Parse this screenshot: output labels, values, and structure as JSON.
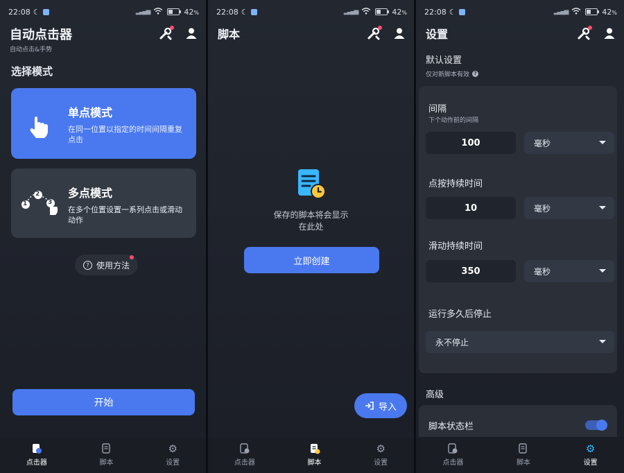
{
  "status": {
    "time": "22:08",
    "battery": "42",
    "battery_unit": "%"
  },
  "colors": {
    "accent": "#4a79ef",
    "card_dark": "#353b45",
    "alert": "#ff4d6d"
  },
  "screen1": {
    "title": "自动点击器",
    "subtitle": "自动点击&手势",
    "section_title": "选择模式",
    "single": {
      "title": "单点模式",
      "desc": "在同一位置以指定的时间间隔重复点击",
      "icon": "tap-hand-icon"
    },
    "multi": {
      "title": "多点模式",
      "desc": "在多个位置设置一系列点击或滑动动作",
      "icon": "multi-point-icon",
      "points": [
        "1",
        "2",
        "3"
      ]
    },
    "howto_label": "使用方法",
    "start_label": "开始"
  },
  "screen2": {
    "title": "脚本",
    "empty_line1": "保存的脚本将会显示",
    "empty_line2": "在此处",
    "create_label": "立即创建",
    "import_label": "导入"
  },
  "screen3": {
    "title": "设置",
    "default_heading": "默认设置",
    "default_note": "仅对新脚本有效",
    "interval": {
      "label": "间隔",
      "sub": "下个动作前的间隔",
      "value": "100",
      "unit": "毫秒"
    },
    "press": {
      "label": "点按持续时间",
      "value": "10",
      "unit": "毫秒"
    },
    "swipe": {
      "label": "滑动持续时间",
      "value": "350",
      "unit": "毫秒"
    },
    "stop": {
      "label": "运行多久后停止",
      "value": "永不停止"
    },
    "advanced_heading": "高级",
    "statusbar_label": "脚本状态栏"
  },
  "nav": {
    "clicker": "点击器",
    "scripts": "脚本",
    "settings": "设置"
  }
}
